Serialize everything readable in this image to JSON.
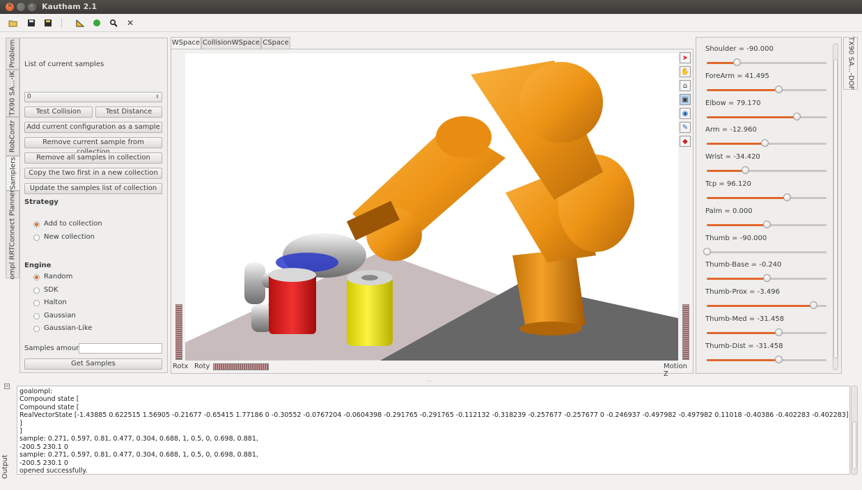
{
  "window": {
    "title": "Kautham 2.1",
    "controls": [
      "close-icon",
      "minimize-icon",
      "maximize-icon"
    ]
  },
  "toolbar": {
    "icons": [
      "open-folder-icon",
      "save-icon",
      "save-as-icon",
      "measure-icon",
      "green-sphere-icon",
      "search-icon",
      "close-x-icon"
    ]
  },
  "left_tabs": [
    "Problem",
    "TX90 SA...-IK",
    "RobContr",
    "Samplers",
    "ompl RRTConnect Planner"
  ],
  "samplers": {
    "list_label": "List of current samples",
    "combo_value": "0",
    "buttons": {
      "test_collision": "Test Collision",
      "test_distance": "Test Distance",
      "add_sample": "Add current configuration as a sample",
      "remove_sample": "Remove current sample from collection",
      "remove_all": "Remove all samples in collection",
      "copy_two": "Copy the two first in a new collection",
      "update_list": "Update the samples list of collection",
      "get_samples": "Get Samples"
    },
    "strategy_label": "Strategy",
    "strategy_options": [
      "Add to collection",
      "New collection"
    ],
    "strategy_selected": "Add to collection",
    "engine_label": "Engine",
    "engine_options": [
      "Random",
      "SDK",
      "Halton",
      "Gaussian",
      "Gaussian-Like"
    ],
    "engine_selected": "Random",
    "samples_amount_label": "Samples amount",
    "samples_amount_value": ""
  },
  "viewer": {
    "tabs": [
      "WSpace",
      "CollisionWSpace",
      "CSpace"
    ],
    "active_tab": "WSpace",
    "labels": {
      "rotx": "Rotx",
      "roty": "Roty",
      "motionz": "Motion Z"
    },
    "tool_icons": [
      "select-arrow-icon",
      "pan-hand-icon",
      "home-view-icon",
      "view-all-icon",
      "eye-view-icon",
      "seek-icon",
      "perspective-icon"
    ]
  },
  "dof_panel": {
    "tab_label": "TX90 SA...-DOF",
    "items": [
      {
        "label": "Shoulder = -90.000",
        "value": 0.25
      },
      {
        "label": "ForeArm = 41.495",
        "value": 0.6
      },
      {
        "label": "Elbow = 79.170",
        "value": 0.75
      },
      {
        "label": "Arm = -12.960",
        "value": 0.48
      },
      {
        "label": "Wrist = -34.420",
        "value": 0.32
      },
      {
        "label": "Tcp = 96.120",
        "value": 0.67
      },
      {
        "label": "Palm = 0.000",
        "value": 0.5
      },
      {
        "label": "Thumb = -90.000",
        "value": 0.0
      },
      {
        "label": "Thumb-Base = -0.240",
        "value": 0.5
      },
      {
        "label": "Thumb-Prox = -3.496",
        "value": 0.89
      },
      {
        "label": "Thumb-Med = -31.458",
        "value": 0.6
      },
      {
        "label": "Thumb-Dist = -31.458",
        "value": 0.6
      }
    ]
  },
  "output": {
    "label": "Output",
    "lines": [
      "goalompl:",
      "Compound state [",
      "Compound state [",
      "RealVectorState [-1.43885 0.622515 1.56905 -0.21677 -0.65415 1.77186 0 -0.30552 -0.0767204 -0.0604398 -0.291765 -0.291765 -0.112132 -0.318239 -0.257677 -0.257677 0 -0.246937 -0.497982 -0.497982 0.11018 -0.40386 -0.402283 -0.402283]",
      "]",
      "]",
      "sample: 0.271, 0.597, 0.81, 0.477, 0.304, 0.688, 1, 0.5, 0, 0.698, 0.881,",
      "-200.5 230.1 0",
      "sample: 0.271, 0.597, 0.81, 0.477, 0.304, 0.688, 1, 0.5, 0, 0.698, 0.881,",
      "-200.5 230.1 0",
      "opened successfully."
    ]
  },
  "colors": {
    "accent": "#e0672a",
    "robot": "#f0951a",
    "can_red": "#e02020",
    "can_yellow": "#f2ea1a"
  }
}
